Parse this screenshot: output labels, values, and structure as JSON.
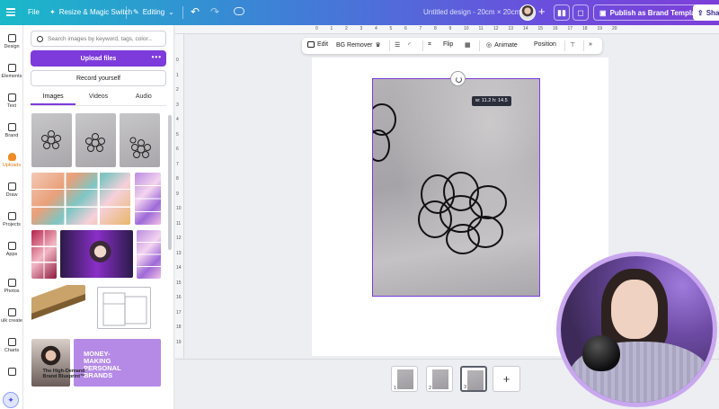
{
  "topbar": {
    "file_label": "File",
    "resize_label": "Resize & Magic Switch",
    "editing_label": "Editing",
    "document_title": "Untitled design - 20cm × 20cm",
    "publish_label": "Publish as Brand Template",
    "share_label": "Sha"
  },
  "rail": {
    "items": [
      {
        "label": "Design",
        "icon": "design-icon"
      },
      {
        "label": "Elements",
        "icon": "elements-icon"
      },
      {
        "label": "Text",
        "icon": "text-icon"
      },
      {
        "label": "Brand",
        "icon": "brand-icon"
      },
      {
        "label": "Uploads",
        "icon": "uploads-icon"
      },
      {
        "label": "Draw",
        "icon": "draw-icon"
      },
      {
        "label": "Projects",
        "icon": "projects-icon"
      },
      {
        "label": "Apps",
        "icon": "apps-icon"
      },
      {
        "label": "Photos",
        "icon": "photos-icon"
      },
      {
        "label": "ulk create",
        "icon": "bulk-create-icon"
      },
      {
        "label": "Charts",
        "icon": "charts-icon"
      }
    ]
  },
  "panel": {
    "search_placeholder": "Search images by keyword, tags, color...",
    "upload_label": "Upload files",
    "upload_more": "•••",
    "record_label": "Record yourself",
    "tabs": [
      "Images",
      "Videos",
      "Audio"
    ],
    "promo_text": "MONEY-\nMAKING\nPERSONAL\nBRANDS",
    "blueprint_text": "The High-Demand Brand Blueprint™"
  },
  "ruler": {
    "top_ticks": [
      "0",
      "1",
      "2",
      "3",
      "4",
      "5",
      "6",
      "7",
      "8",
      "9",
      "10",
      "11",
      "12",
      "13",
      "14",
      "15",
      "16",
      "17",
      "18",
      "19",
      "20"
    ],
    "left_ticks": [
      "0",
      "1",
      "2",
      "3",
      "4",
      "5",
      "6",
      "7",
      "8",
      "9",
      "10",
      "11",
      "12",
      "13",
      "14",
      "15",
      "16",
      "17",
      "18",
      "19"
    ]
  },
  "context_bar": {
    "edit_label": "Edit",
    "bg_remover_label": "BG Remover",
    "flip_label": "Flip",
    "animate_label": "Animate",
    "position_label": "Position"
  },
  "canvas": {
    "size_tooltip": "w: 11.2 h: 14.5"
  },
  "pages": [
    "1",
    "2",
    "3"
  ],
  "colors": {
    "accent": "#7d3bdc",
    "uploads_active": "#f08a24"
  }
}
